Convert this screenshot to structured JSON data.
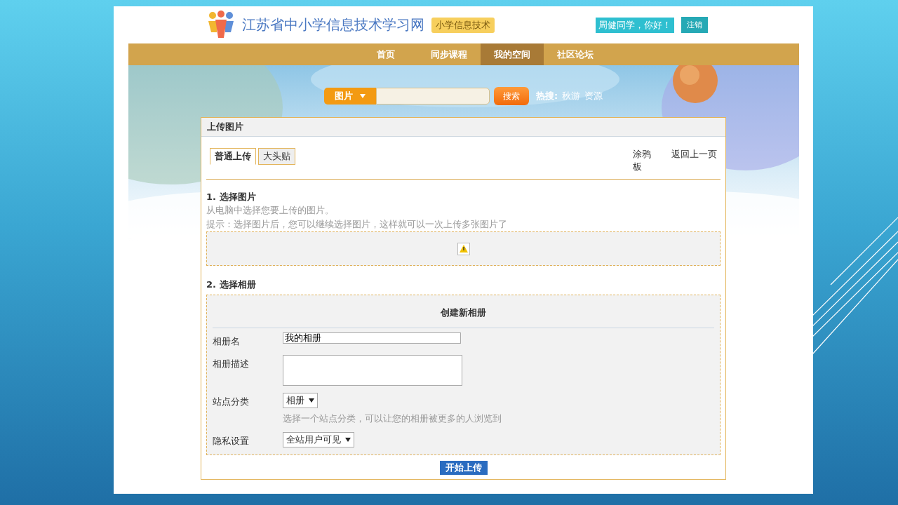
{
  "header": {
    "site_title": "江苏省中小学信息技术学习网",
    "site_tag": "小学信息技术",
    "greeting": "周健同学，你好！",
    "logout": "注销"
  },
  "nav": [
    {
      "label": "首页",
      "selected": false
    },
    {
      "label": "同步课程",
      "selected": false
    },
    {
      "label": "我的空间",
      "selected": true
    },
    {
      "label": "社区论坛",
      "selected": false
    }
  ],
  "search": {
    "category": "图片",
    "button": "搜索",
    "hot_label": "热搜:",
    "hot_terms": [
      "秋游",
      "资源"
    ]
  },
  "panel": {
    "title": "上传图片",
    "tabs": [
      {
        "label": "普通上传",
        "selected": true
      },
      {
        "label": "大头贴",
        "selected": false
      }
    ],
    "links": [
      "涂鸦板",
      "返回上一页"
    ],
    "step1": {
      "heading": "1. 选择图片",
      "lines": [
        "从电脑中选择您要上传的图片。",
        "提示：选择图片后，您可以继续选择图片，这样就可以一次上传多张图片了"
      ]
    },
    "step2": {
      "heading": "2. 选择相册",
      "form_title": "创建新相册",
      "fields": [
        {
          "kind": "text",
          "label": "相册名",
          "value": "我的相册"
        },
        {
          "kind": "textarea",
          "label": "相册描述"
        },
        {
          "kind": "select",
          "label": "站点分类",
          "value": "相册",
          "hint": "选择一个站点分类，可以让您的相册被更多的人浏览到"
        },
        {
          "kind": "select",
          "label": "隐私设置",
          "value": "全站用户可见"
        }
      ]
    },
    "submit": "开始上传"
  }
}
